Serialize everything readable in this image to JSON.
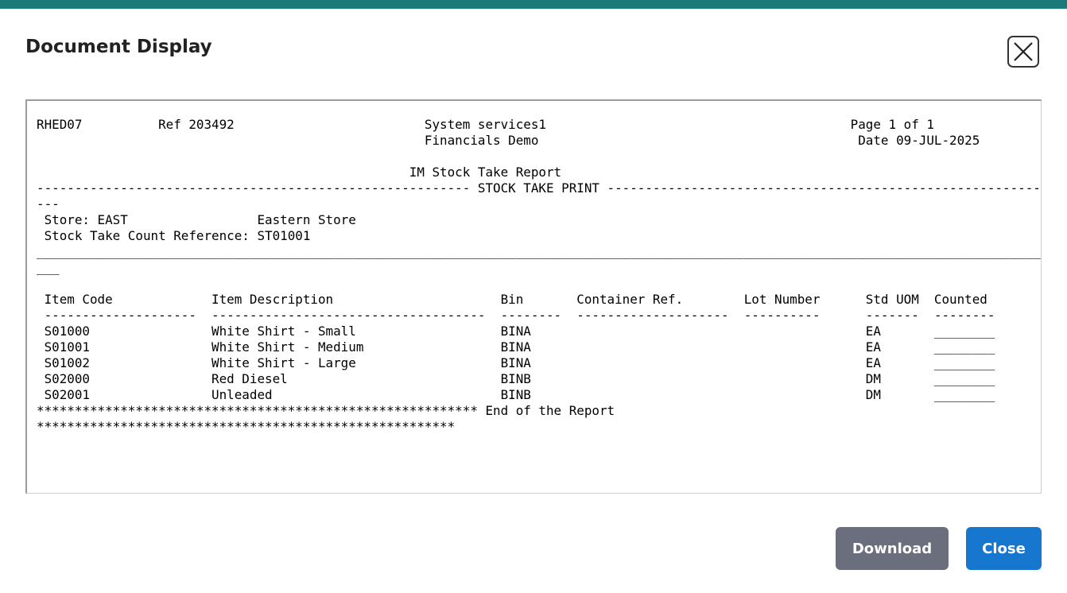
{
  "dialog": {
    "title": "Document Display",
    "accent_color": "#1a7a7a"
  },
  "document": {
    "text": "RHED07          Ref 203492                         System services1                                        Page 1 of 1\n                                                   Financials Demo                                          Date 09-JUL-2025\n\n                                                 IM Stock Take Report\n--------------------------------------------------------- STOCK TAKE PRINT ----------------------------------------------------------\n---\n Store: EAST                 Eastern Store\n Stock Take Count Reference: ST01001\n_____________________________________________________________________________________________________________________________________\n___\n\n Item Code             Item Description                      Bin       Container Ref.        Lot Number      Std UOM  Counted\n --------------------  ------------------------------------  --------  --------------------  ----------      -------  --------\n S01000                White Shirt - Small                   BINA                                            EA       ________\n S01001                White Shirt - Medium                  BINA                                            EA       ________\n S01002                White Shirt - Large                   BINA                                            EA       ________\n S02000                Red Diesel                            BINB                                            DM       ________\n S02001                Unleaded                              BINB                                            DM       ________\n********************************************************** End of the Report\n*******************************************************"
  },
  "buttons": {
    "download_label": "Download",
    "close_label": "Close",
    "download_color": "#6b6e7c",
    "close_color": "#1777cf"
  },
  "icons": {
    "close": "close-icon"
  }
}
